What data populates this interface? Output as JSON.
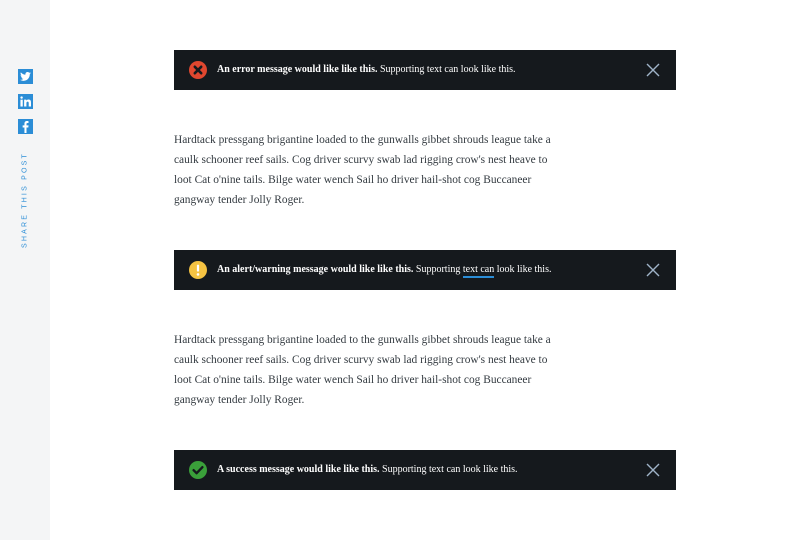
{
  "share": {
    "label": "SHARE THIS POST",
    "icons": [
      "twitter-icon",
      "linkedin-icon",
      "facebook-icon"
    ],
    "accent": "#2b8dd6"
  },
  "alerts": {
    "error": {
      "strong": "An error message would like like this.",
      "supporting_before": " Supporting text can look like this.",
      "icon": "error-x-icon",
      "icon_color": "#e0472f",
      "close_icon": "close-icon"
    },
    "warning": {
      "strong": "An alert/warning message would like like this.",
      "supporting_before": " Supporting ",
      "link": "text can",
      "supporting_after": " look like this.",
      "icon": "warning-exclamation-icon",
      "icon_color": "#f5c342",
      "close_icon": "close-icon"
    },
    "success": {
      "strong": "A success message would like like this.",
      "supporting_before": " Supporting text can look like this.",
      "icon": "success-check-icon",
      "icon_color": "#3aa03a",
      "close_icon": "close-icon"
    },
    "background": "#15191d"
  },
  "paragraphs": [
    {
      "lines": [
        "Hardtack pressgang brigantine loaded to the gunwalls gibbet shrouds league take a",
        "caulk schooner reef sails. Cog driver scurvy swab lad rigging crow's nest heave to",
        "loot Cat o'nine tails. Bilge water wench Sail ho driver hail-shot cog Buccaneer",
        "gangway tender Jolly Roger."
      ]
    },
    {
      "lines": [
        "Hardtack pressgang brigantine loaded to the gunwalls gibbet shrouds league take a",
        "caulk schooner reef sails. Cog driver scurvy swab lad rigging crow's nest heave to",
        "loot Cat o'nine tails. Bilge water wench Sail ho driver hail-shot cog Buccaneer",
        "gangway tender Jolly Roger."
      ]
    }
  ]
}
